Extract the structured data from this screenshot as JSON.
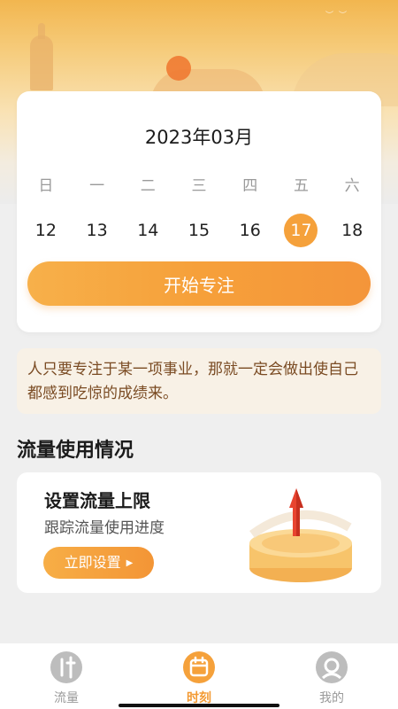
{
  "calendar": {
    "title": "2023年03月",
    "weekdays": [
      "日",
      "一",
      "二",
      "三",
      "四",
      "五",
      "六"
    ],
    "dates": [
      "12",
      "13",
      "14",
      "15",
      "16",
      "17",
      "18"
    ],
    "selected_date": "17",
    "focus_button": "开始专注"
  },
  "quote": {
    "text": "人只要专注于某一项事业，那就一定会做出使自己都感到吃惊的成绩来。"
  },
  "traffic": {
    "section_title": "流量使用情况",
    "card_title": "设置流量上限",
    "card_subtitle": "跟踪流量使用进度",
    "button_label": "立即设置"
  },
  "tabs": [
    {
      "label": "流量",
      "icon": "traffic-icon",
      "active": false
    },
    {
      "label": "时刻",
      "icon": "calendar-icon",
      "active": true
    },
    {
      "label": "我的",
      "icon": "profile-icon",
      "active": false
    }
  ],
  "colors": {
    "accent": "#f5a13b",
    "quote_text": "#7a4b23",
    "quote_bg": "#f8f1e6"
  }
}
